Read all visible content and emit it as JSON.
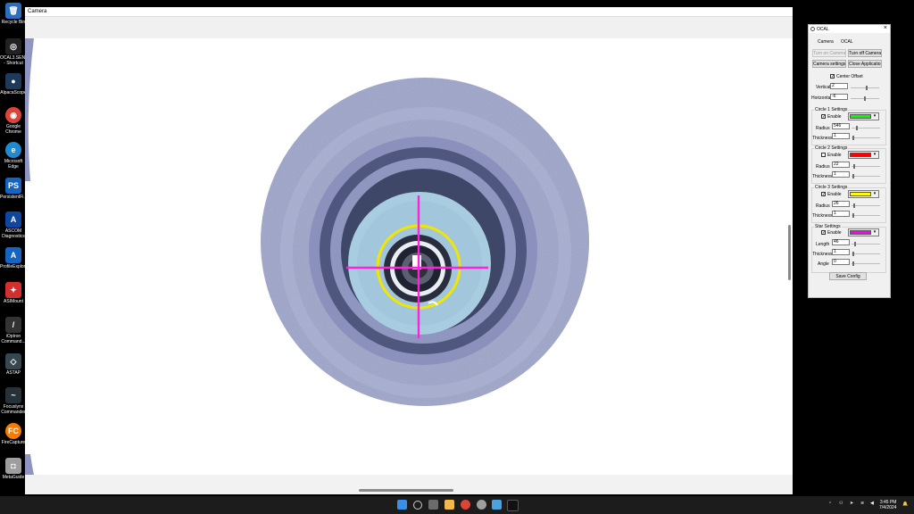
{
  "desktop": {
    "icons": [
      {
        "label": "Recycle Bin",
        "glyph": "🗑",
        "color": "#2a6ebd"
      },
      {
        "label": "OCAL3.SEN...\n- Shortcut",
        "glyph": "◎",
        "color": "#222222"
      },
      {
        "label": "AlpacaScope",
        "glyph": "●",
        "color": "#1e3a5a"
      },
      {
        "label": "Google\nChrome",
        "glyph": "◉",
        "color": "#db4437"
      },
      {
        "label": "Microsoft\nEdge",
        "glyph": "e",
        "color": "#1f8ad2"
      },
      {
        "label": "PersistentFi...",
        "glyph": "PS",
        "color": "#1565c0"
      },
      {
        "label": "ASCOM\nDiagnostics",
        "glyph": "A",
        "color": "#0d47a1"
      },
      {
        "label": "ProfileExplor...",
        "glyph": "A",
        "color": "#1565c0"
      },
      {
        "label": "ASIMount",
        "glyph": "✦",
        "color": "#d32f2f"
      },
      {
        "label": "iOptron\nCommand...",
        "glyph": "/",
        "color": "#333333"
      },
      {
        "label": "ASTAP",
        "glyph": "◇",
        "color": "#37474f"
      },
      {
        "label": "Focuslynx\nCommander",
        "glyph": "~",
        "color": "#263238"
      },
      {
        "label": "FireCapture",
        "glyph": "FC",
        "color": "#f57c00"
      },
      {
        "label": "MetaGuide",
        "glyph": "◘",
        "color": "#9e9e9e"
      }
    ]
  },
  "camera_window": {
    "title": "Camera"
  },
  "ocal": {
    "title": "OCAL",
    "tabs": [
      "Camera",
      "OCAL"
    ],
    "buttons": {
      "turn_on_camera": "Turn on Camera",
      "turn_off_camera": "Turn off Camera",
      "camera_settings": "Camera settings",
      "close_application": "Close Application",
      "save_config": "Save Config"
    },
    "center_offset": {
      "label": "Center Offset",
      "checked": true,
      "vertical_label": "Vertical",
      "vertical_value": "2",
      "horizontal_label": "Horizontal",
      "horizontal_value": "-6"
    },
    "circle1": {
      "title": "Circle 1 Settings",
      "enable_label": "Enable",
      "enabled": true,
      "color": "#00ff00",
      "radius_label": "Radius",
      "radius_value": "546",
      "thickness_label": "Thickness",
      "thickness_value": "1"
    },
    "circle2": {
      "title": "Circle 2 Settings",
      "enable_label": "Enable",
      "enabled": false,
      "color": "#ff0000",
      "radius_label": "Radius",
      "radius_value": "22",
      "thickness_label": "Thickness",
      "thickness_value": "1"
    },
    "circle3": {
      "title": "Circle 3 Settings",
      "enable_label": "Enable",
      "enabled": true,
      "color": "#ffff00",
      "radius_label": "Radius",
      "radius_value": "26",
      "thickness_label": "Thickness",
      "thickness_value": "1"
    },
    "star": {
      "title": "Star Settings",
      "enable_label": "Enable",
      "enabled": true,
      "color": "#ff00ff",
      "length_label": "Length",
      "length_value": "46",
      "thickness_label": "Thickness",
      "thickness_value": "1",
      "angle_label": "Angle",
      "angle_value": "0"
    }
  },
  "taskbar": {
    "time": "3:45 PM",
    "date": "7/4/2024"
  },
  "colors": {
    "crosshair": "#ff22dd",
    "reticle_circle": "#f2e600"
  }
}
